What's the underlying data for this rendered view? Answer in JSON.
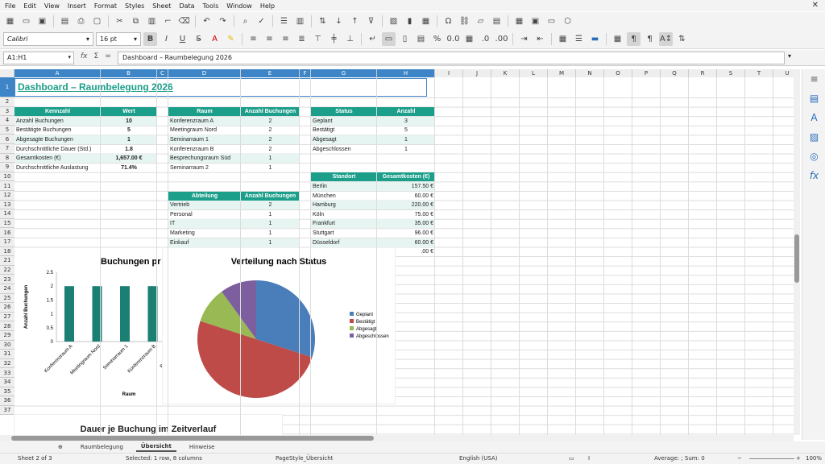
{
  "menu": [
    "File",
    "Edit",
    "View",
    "Insert",
    "Format",
    "Styles",
    "Sheet",
    "Data",
    "Tools",
    "Window",
    "Help"
  ],
  "toolbar2": {
    "font_name": "Calibri",
    "font_size": "16 pt"
  },
  "formula_bar": {
    "name_box": "A1:H1",
    "content": "Dashboard – Raumbelegung 2026"
  },
  "columns": [
    "A",
    "B",
    "C",
    "D",
    "E",
    "F",
    "G",
    "H",
    "I",
    "J",
    "K",
    "L",
    "M",
    "N",
    "O",
    "P",
    "Q",
    "R",
    "S",
    "T",
    "U"
  ],
  "rows": [
    "1",
    "2",
    "3",
    "4",
    "5",
    "6",
    "7",
    "8",
    "9",
    "10",
    "11",
    "12",
    "13",
    "14",
    "15",
    "16",
    "17",
    "18",
    "21",
    "22",
    "23",
    "24",
    "25",
    "26",
    "27",
    "28",
    "29",
    "30",
    "31",
    "32",
    "33",
    "34",
    "35",
    "36",
    "37"
  ],
  "title": "Dashboard – Raumbelegung 2026",
  "kpi": {
    "headers": [
      "Kennzahl",
      "Wert"
    ],
    "rows": [
      [
        "Anzahl Buchungen",
        "10"
      ],
      [
        "Bestätigte Buchungen",
        "5"
      ],
      [
        "Abgesagte Buchungen",
        "1"
      ],
      [
        "Durchschnittliche Dauer (Std.)",
        "1.8"
      ],
      [
        "Gesamtkosten (€)",
        "1,657.00 €"
      ],
      [
        "Durchschnittliche Auslastung",
        "71.4%"
      ]
    ]
  },
  "rooms": {
    "headers": [
      "Raum",
      "Anzahl Buchungen"
    ],
    "rows": [
      [
        "Konferenzraum A",
        "2"
      ],
      [
        "Meetingraum Nord",
        "2"
      ],
      [
        "Seminarraum 1",
        "2"
      ],
      [
        "Konferenzraum B",
        "2"
      ],
      [
        "Besprechungsraum Süd",
        "1"
      ],
      [
        "Seminarraum 2",
        "1"
      ]
    ]
  },
  "status": {
    "headers": [
      "Status",
      "Anzahl"
    ],
    "rows": [
      [
        "Geplant",
        "3"
      ],
      [
        "Bestätigt",
        "5"
      ],
      [
        "Abgesagt",
        "1"
      ],
      [
        "Abgeschlossen",
        "1"
      ]
    ]
  },
  "departments": {
    "headers": [
      "Abteilung",
      "Anzahl Buchungen"
    ],
    "rows": [
      [
        "Vertrieb",
        "2"
      ],
      [
        "Personal",
        "1"
      ],
      [
        "IT",
        "1"
      ],
      [
        "Marketing",
        "1"
      ],
      [
        "Einkauf",
        "1"
      ]
    ]
  },
  "locations": {
    "headers": [
      "Standort",
      "Gesamtkosten (€)"
    ],
    "rows": [
      [
        "Berlin",
        "157.50 €"
      ],
      [
        "München",
        "60.00 €"
      ],
      [
        "Hamburg",
        "220.00 €"
      ],
      [
        "Köln",
        "75.00 €"
      ],
      [
        "Frankfurt",
        "35.00 €"
      ],
      [
        "Stuttgart",
        "96.00 €"
      ],
      [
        "Düsseldorf",
        "60.00 €"
      ]
    ],
    "overflow_value": ".00 €"
  },
  "chart_data": [
    {
      "type": "bar",
      "title": "Buchungen pr",
      "xlabel": "Raum",
      "ylabel": "Anzahl Buchungen",
      "categories": [
        "Konferenzraum A",
        "Meetingraum Nord",
        "Seminarraum 1",
        "Konferenzraum B",
        "Besprechungs"
      ],
      "values": [
        2,
        2,
        2,
        2
      ],
      "yticks": [
        "0",
        "0.5",
        "1",
        "1.5",
        "2",
        "2.5"
      ],
      "ylim": [
        0,
        2.5
      ],
      "color": "#1b7f73"
    },
    {
      "type": "pie",
      "title": "Verteilung nach Status",
      "categories": [
        "Geplant",
        "Bestätigt",
        "Abgesagt",
        "Abgeschlossen"
      ],
      "values": [
        3,
        5,
        1,
        1
      ],
      "colors": [
        "#4a7ebb",
        "#be4b48",
        "#98b954",
        "#7d5fa0"
      ],
      "legend": "right"
    },
    {
      "type": "line",
      "title": "Dauer je Buchung im Zeitverlauf"
    }
  ],
  "sheet_tabs": [
    "Raumbelegung",
    "Übersicht",
    "Hinweise"
  ],
  "active_tab": "Übersicht",
  "status_bar": {
    "sheet": "Sheet 2 of 3",
    "selection": "Selected: 1 row, 8 columns",
    "page_style": "PageStyle_Übersicht",
    "language": "English (USA)",
    "summary": "Average: ; Sum: 0",
    "zoom": "100%"
  }
}
